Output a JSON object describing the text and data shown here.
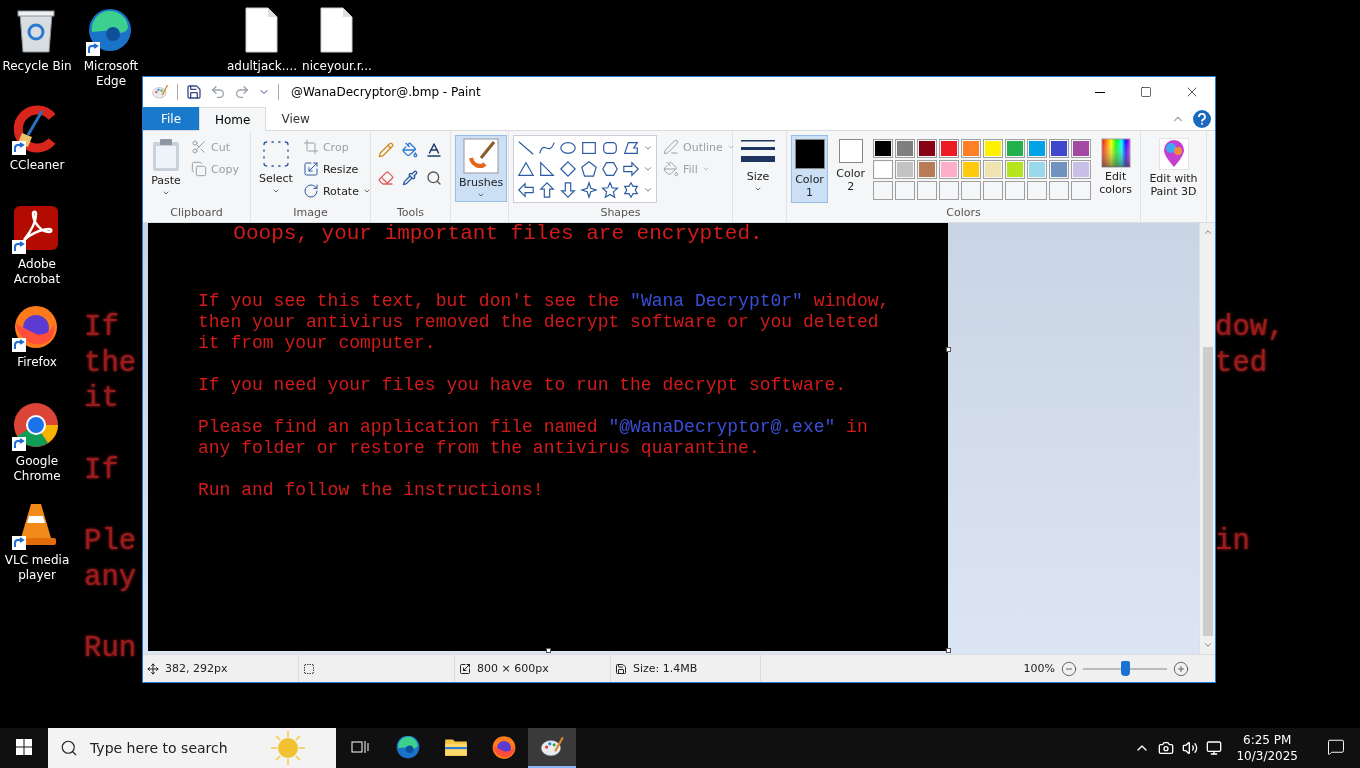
{
  "desktop": {
    "icons": [
      {
        "kind": "recycle-bin",
        "label": "Recycle Bin",
        "shortcut": false
      },
      {
        "kind": "edge",
        "label": "Microsoft Edge",
        "shortcut": true
      },
      {
        "kind": "document",
        "label": "adultjack....",
        "shortcut": false
      },
      {
        "kind": "document",
        "label": "niceyour.r...",
        "shortcut": false
      },
      {
        "kind": "ccleaner",
        "label": "CCleaner",
        "shortcut": true
      },
      {
        "kind": "acrobat",
        "label": "Adobe Acrobat",
        "shortcut": true
      },
      {
        "kind": "firefox",
        "label": "Firefox",
        "shortcut": true
      },
      {
        "kind": "chrome",
        "label": "Google Chrome",
        "shortcut": true
      },
      {
        "kind": "vlc",
        "label": "VLC media player",
        "shortcut": true
      }
    ],
    "wallpaper_left": [
      {
        "kind": "text",
        "text": "If"
      },
      {
        "kind": "text",
        "text": "the"
      },
      {
        "kind": "text",
        "text": "it"
      },
      {
        "kind": "blank"
      },
      {
        "kind": "text",
        "text": "If"
      },
      {
        "kind": "blank"
      },
      {
        "kind": "text",
        "text": "Ple"
      },
      {
        "kind": "text",
        "text": "any"
      },
      {
        "kind": "blank"
      },
      {
        "kind": "text",
        "text": "Run"
      }
    ],
    "wallpaper_right": [
      {
        "kind": "text",
        "text": "dow,"
      },
      {
        "kind": "text",
        "text": "ted"
      },
      {
        "kind": "blank"
      },
      {
        "kind": "blank"
      },
      {
        "kind": "blank"
      },
      {
        "kind": "blank"
      },
      {
        "kind": "text",
        "text": "in"
      }
    ]
  },
  "paint": {
    "title": "@WanaDecryptor@.bmp - Paint",
    "tabs": [
      {
        "label": "File",
        "kind": "file",
        "selected": false
      },
      {
        "label": "Home",
        "kind": "tab",
        "selected": true
      },
      {
        "label": "View",
        "kind": "tab",
        "selected": false
      }
    ],
    "clipboard": {
      "label": "Clipboard",
      "paste": "Paste",
      "cut": {
        "label": "Cut",
        "disabled": true
      },
      "copy": {
        "label": "Copy",
        "disabled": true
      }
    },
    "image": {
      "label": "Image",
      "select": "Select",
      "crop": {
        "label": "Crop",
        "disabled": true
      },
      "resize": {
        "label": "Resize",
        "disabled": false
      },
      "rotate": {
        "label": "Rotate",
        "disabled": false
      }
    },
    "tools": {
      "label": "Tools"
    },
    "brushes": {
      "label": "Brushes",
      "selected": true
    },
    "shapes": {
      "label": "Shapes",
      "outline": {
        "label": "Outline",
        "disabled": true
      },
      "fill": {
        "label": "Fill",
        "disabled": true
      }
    },
    "size": {
      "label": "Size"
    },
    "colors": {
      "label": "Colors",
      "current": [
        {
          "label": "Color 1",
          "color": "#000000",
          "selected": true
        },
        {
          "label": "Color 2",
          "color": "#ffffff",
          "selected": false
        }
      ],
      "palette": [
        {
          "color": "#000000"
        },
        {
          "color": "#7f7f7f"
        },
        {
          "color": "#880015"
        },
        {
          "color": "#ed1c24"
        },
        {
          "color": "#ff7f27"
        },
        {
          "color": "#fff200"
        },
        {
          "color": "#22b14c"
        },
        {
          "color": "#00a2e8"
        },
        {
          "color": "#3f48cc"
        },
        {
          "color": "#a349a4"
        },
        {
          "color": "#ffffff"
        },
        {
          "color": "#c3c3c3"
        },
        {
          "color": "#b97a57"
        },
        {
          "color": "#ffaec9"
        },
        {
          "color": "#ffc90e"
        },
        {
          "color": "#efe4b0"
        },
        {
          "color": "#b5e61d"
        },
        {
          "color": "#99d9ea"
        },
        {
          "color": "#7092be"
        },
        {
          "color": "#c8bfe7"
        }
      ],
      "custom_slots": [
        {
          "kind": "empty"
        },
        {
          "kind": "empty"
        },
        {
          "kind": "empty"
        },
        {
          "kind": "empty"
        },
        {
          "kind": "empty"
        },
        {
          "kind": "empty"
        },
        {
          "kind": "empty"
        },
        {
          "kind": "empty"
        },
        {
          "kind": "empty"
        },
        {
          "kind": "empty"
        }
      ],
      "edit": "Edit colors"
    },
    "paint3d": "Edit with Paint 3D",
    "canvas": {
      "heading": "Ooops, your important files are encrypted.",
      "paragraphs": [
        {
          "lines": [
            [
              {
                "text": "If you see this text, but don't see the ",
                "highlight": false
              },
              {
                "text": "\"Wana Decrypt0r\"",
                "highlight": true
              },
              {
                "text": " window,",
                "highlight": false
              }
            ],
            [
              {
                "text": "then your antivirus removed the decrypt software or you deleted",
                "highlight": false
              }
            ],
            [
              {
                "text": "it from your computer.",
                "highlight": false
              }
            ]
          ]
        },
        {
          "lines": [
            [
              {
                "text": "If you need your files you have to run the decrypt software.",
                "highlight": false
              }
            ]
          ]
        },
        {
          "lines": [
            [
              {
                "text": "Please find an application file named ",
                "highlight": false
              },
              {
                "text": "\"@WanaDecryptor@.exe\"",
                "highlight": true
              },
              {
                "text": " in",
                "highlight": false
              }
            ],
            [
              {
                "text": "any folder or restore from the antivirus quarantine.",
                "highlight": false
              }
            ]
          ]
        },
        {
          "lines": [
            [
              {
                "text": "Run and follow the instructions!",
                "highlight": false
              }
            ]
          ]
        }
      ]
    },
    "status": {
      "cursor": "382, 292px",
      "dimensions": "800 × 600px",
      "size": "Size: 1.4MB",
      "zoom": "100%",
      "zoom_slider": {
        "level": 0.5
      }
    }
  },
  "taskbar": {
    "search": {
      "placeholder": "Type here to search"
    },
    "apps": [
      {
        "kind": "edge",
        "selected": false
      },
      {
        "kind": "explorer",
        "selected": false
      },
      {
        "kind": "firefox",
        "selected": false
      },
      {
        "kind": "paint",
        "selected": true
      }
    ],
    "time": "6:25 PM",
    "date": "10/3/2025"
  }
}
